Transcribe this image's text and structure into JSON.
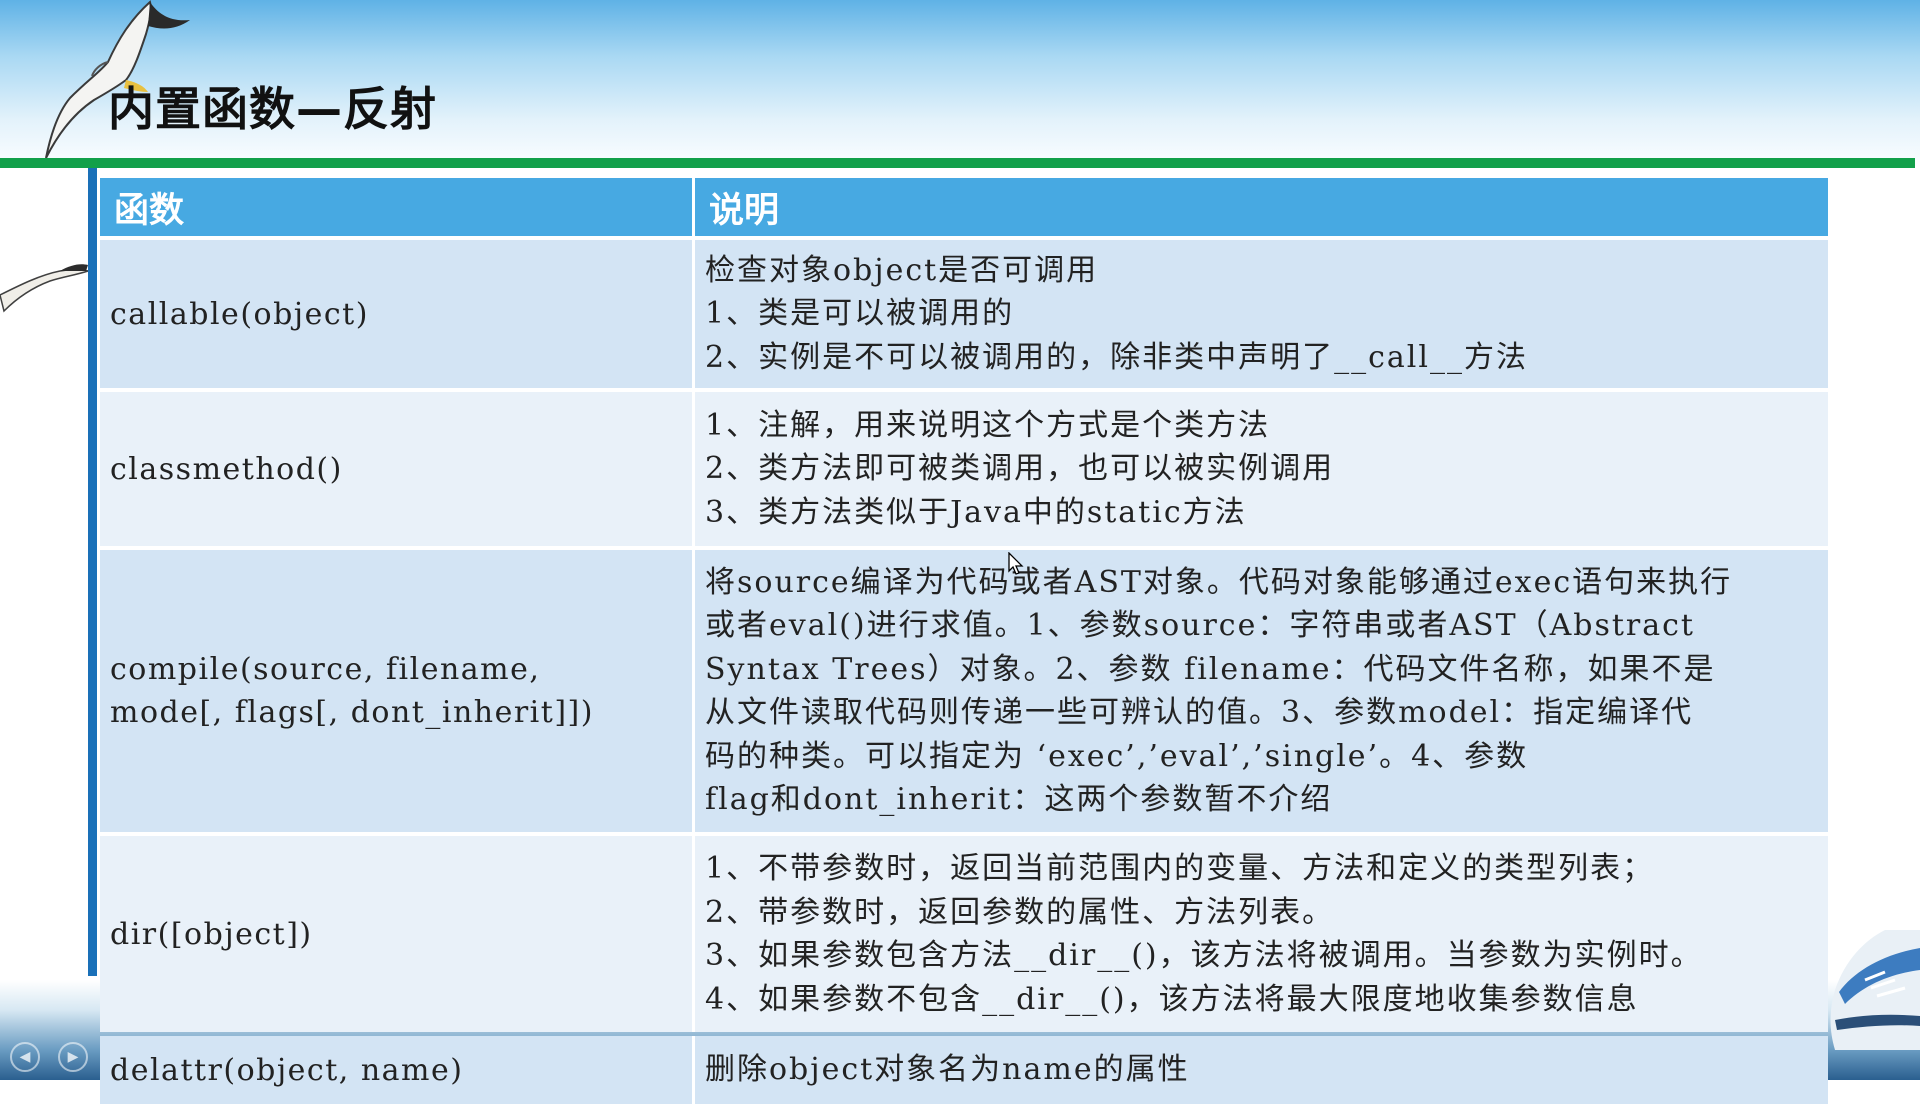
{
  "slide": {
    "title": "内置函数—反射"
  },
  "table": {
    "headers": [
      "函数",
      "说明"
    ],
    "rows": [
      {
        "function": "callable(object)",
        "function_lines": [
          "callable(object)"
        ],
        "description_lines": [
          "检查对象object是否可调用",
          "1、类是可以被调用的",
          "2、实例是不可以被调用的，除非类中声明了__call__方法"
        ]
      },
      {
        "function": "classmethod()",
        "function_lines": [
          "classmethod()"
        ],
        "description_lines": [
          "1、注解，用来说明这个方式是个类方法",
          "2、类方法即可被类调用，也可以被实例调用",
          "3、类方法类似于Java中的static方法"
        ]
      },
      {
        "function": "compile(source, filename, mode[, flags[, dont_inherit]])",
        "function_lines": [
          "compile(source, filename,",
          "mode[, flags[, dont_inherit]])"
        ],
        "description_lines": [
          "将source编译为代码或者AST对象。代码对象能够通过exec语句来执行",
          "或者eval()进行求值。1、参数source：字符串或者AST（Abstract",
          "Syntax Trees）对象。2、参数 filename：代码文件名称，如果不是",
          "从文件读取代码则传递一些可辨认的值。3、参数model：指定编译代",
          "码的种类。可以指定为 ‘exec’,’eval’,’single’。4、参数",
          "flag和dont_inherit：这两个参数暂不介绍"
        ]
      },
      {
        "function": "dir([object])",
        "function_lines": [
          "dir([object])"
        ],
        "description_lines": [
          "1、不带参数时，返回当前范围内的变量、方法和定义的类型列表；",
          "2、带参数时，返回参数的属性、方法列表。",
          "3、如果参数包含方法__dir__()，该方法将被调用。当参数为实例时。",
          "4、如果参数不包含__dir__()，该方法将最大限度地收集参数信息"
        ]
      },
      {
        "function": "delattr(object, name)",
        "function_lines": [
          "delattr(object, name)"
        ],
        "description_lines": [
          "删除object对象名为name的属性"
        ]
      }
    ]
  },
  "nav": {
    "prev_icon": "◀",
    "next_icon": "▶"
  },
  "colors": {
    "header_fill": "#47a9e2",
    "row_odd": "#d3e4f4",
    "row_even": "#e9f1f9",
    "title_rule": "#12a04a",
    "side_rule": "#1a70b8"
  },
  "icons": [
    "seagull-icon",
    "ship-icon",
    "nav-prev-icon",
    "nav-next-icon",
    "cursor-icon"
  ]
}
